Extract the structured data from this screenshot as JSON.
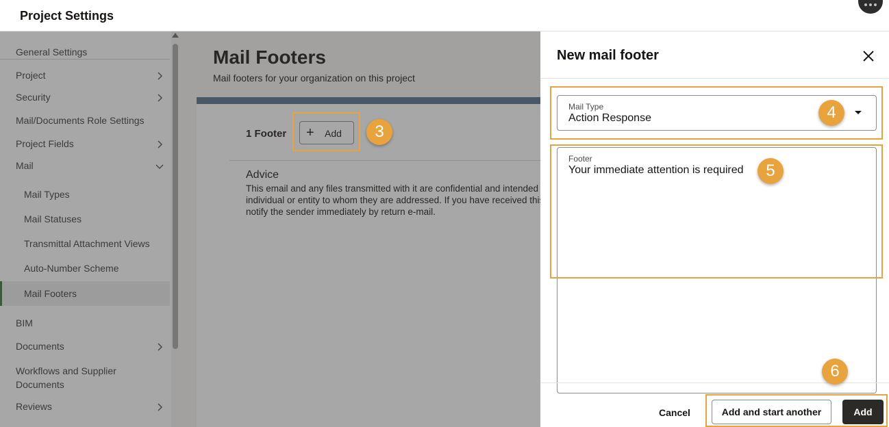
{
  "header": {
    "title": "Project Settings"
  },
  "sidebar": {
    "items": [
      {
        "label": "General Settings"
      },
      {
        "label": "Project"
      },
      {
        "label": "Security"
      },
      {
        "label": "Mail/Documents Role Settings"
      },
      {
        "label": "Project Fields"
      },
      {
        "label": "Mail"
      },
      {
        "label": "Mail Types"
      },
      {
        "label": "Mail Statuses"
      },
      {
        "label": "Transmittal Attachment Views"
      },
      {
        "label": "Auto-Number Scheme"
      },
      {
        "label": "Mail Footers"
      },
      {
        "label": "BIM"
      },
      {
        "label": "Documents"
      },
      {
        "label": "Workflows and Supplier Documents"
      },
      {
        "label": "Reviews"
      }
    ],
    "selected": "Mail Footers"
  },
  "main": {
    "title": "Mail Footers",
    "subtitle": "Mail footers for your organization on this project",
    "footer_count": "1 Footer",
    "add_label": "Add",
    "advice": {
      "title": "Advice",
      "lines": [
        "This email and any files transmitted with it are confidential and intended solely for the use of the",
        "individual or entity to whom they are addressed. If you have received this email in error please",
        "notify the sender immediately by return e-mail."
      ]
    }
  },
  "drawer": {
    "title": "New mail footer",
    "mail_type": {
      "label": "Mail Type",
      "value": "Action Response"
    },
    "footer": {
      "label": "Footer",
      "value": "Your immediate attention is required"
    },
    "cancel_label": "Cancel",
    "add_another_label": "Add and start another",
    "add_label": "Add"
  },
  "callouts": {
    "step3": "3",
    "step4": "4",
    "step5": "5",
    "step6": "6"
  },
  "colors": {
    "callout": "#e8a33d",
    "primary_button": "#2c2a27",
    "selected_bar": "#3f6e3f"
  }
}
